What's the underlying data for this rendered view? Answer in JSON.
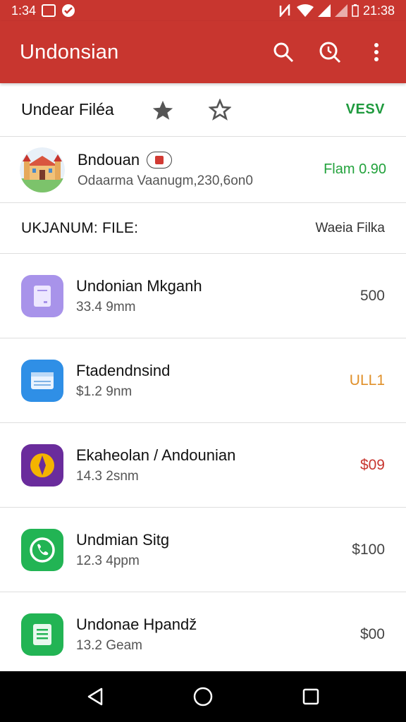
{
  "status_bar": {
    "time_left": "1:34",
    "time_right": "21:38"
  },
  "app_bar": {
    "title": "Undonsian",
    "search_icon": "search-icon",
    "history_icon": "history-search-icon",
    "menu_icon": "more-vert-icon"
  },
  "section_header": {
    "title": "Undear Filéa",
    "action": "VESV"
  },
  "featured": {
    "title": "Bndouan",
    "subtitle": "Odaarma Vaanugm,230,6on0",
    "value": "Flam 0.90",
    "value_color": "#22a23c"
  },
  "sub_header": {
    "title": "UKJANUM: FILE:",
    "right": "Waeia Filka"
  },
  "items": [
    {
      "title": "Undonian Mkganh",
      "subtitle": "33.4 9mm",
      "value": "500",
      "value_color": "#444444",
      "icon_bg": "#a893ea",
      "icon": "notes-icon"
    },
    {
      "title": "Ftadendnsind",
      "subtitle": "$1.2 9nm",
      "value": "ULL1",
      "value_color": "#e0902a",
      "icon_bg": "#2f8fe6",
      "icon": "window-icon"
    },
    {
      "title": "Ekaheolan / Andounian",
      "subtitle": "14.3 2snm",
      "value": "$09",
      "value_color": "#c8362f",
      "icon_bg": "#6a2c9c",
      "icon": "compass-icon"
    },
    {
      "title": "Undmian Sitg",
      "subtitle": "12.3 4ppm",
      "value": "$100",
      "value_color": "#444444",
      "icon_bg": "#22b454",
      "icon": "phone-icon"
    },
    {
      "title": "Undonae Hpandž",
      "subtitle": "13.2 Geam",
      "value": "$00",
      "value_color": "#444444",
      "icon_bg": "#22b454",
      "icon": "document-icon"
    }
  ],
  "colors": {
    "accent": "#c8362f",
    "positive": "#1f9a3e"
  }
}
